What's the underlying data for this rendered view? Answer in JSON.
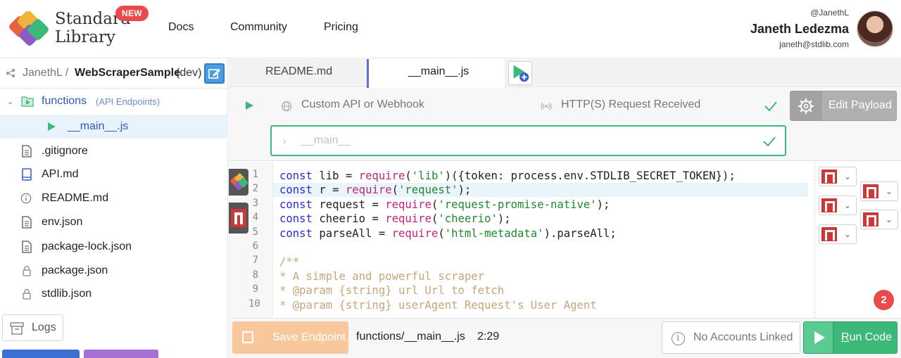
{
  "header": {
    "brand_line1": "Standard",
    "brand_line2": "Library",
    "new_badge": "NEW",
    "nav": {
      "docs": "Docs",
      "community": "Community",
      "pricing": "Pricing"
    },
    "user": {
      "handle": "@JanethL",
      "name": "Janeth Ledezma",
      "email": "janeth@stdlib.com"
    }
  },
  "sidebar": {
    "breadcrumb": {
      "owner": "JanethL /",
      "project": "WebScraperSample",
      "env": "(dev)"
    },
    "functions_folder": {
      "label": "functions",
      "sublabel": "(API Endpoints)"
    },
    "selected_file": "__main__.js",
    "files": [
      {
        "label": ".gitignore",
        "icon": "document-icon"
      },
      {
        "label": "API.md",
        "icon": "book-icon"
      },
      {
        "label": "README.md",
        "icon": "info-icon"
      },
      {
        "label": "env.json",
        "icon": "document-icon"
      },
      {
        "label": "package-lock.json",
        "icon": "document-icon"
      },
      {
        "label": "package.json",
        "icon": "lock-icon"
      },
      {
        "label": "stdlib.json",
        "icon": "lock-icon"
      }
    ],
    "logs_label": "Logs"
  },
  "editor": {
    "tabs": [
      {
        "label": "README.md",
        "active": false
      },
      {
        "label": "__main__.js",
        "active": true
      }
    ],
    "request_bar": {
      "api_label": "Custom API or Webhook",
      "http_label": "HTTP(S) Request Received",
      "edit_payload_label": "Edit Payload",
      "function_name": "__main__"
    },
    "line_numbers": [
      "1",
      "2",
      "3",
      "4",
      "5",
      "6",
      "7",
      "8",
      "9",
      "10"
    ],
    "code": [
      {
        "t": [
          [
            "kw",
            "const"
          ],
          [
            "",
            "lib = "
          ],
          [
            "fnc",
            "require"
          ],
          [
            "",
            "("
          ],
          [
            "str",
            "'lib'"
          ],
          [
            "",
            ")({token: process.env.STDLIB_SECRET_TOKEN});"
          ]
        ]
      },
      {
        "t": [
          [
            "kw",
            "const"
          ],
          [
            "",
            "r = "
          ],
          [
            "fnc",
            "require"
          ],
          [
            "",
            "("
          ],
          [
            "str",
            "'request'"
          ],
          [
            "",
            ");"
          ]
        ],
        "highlight": true
      },
      {
        "t": [
          [
            "kw",
            "const"
          ],
          [
            "",
            "request = "
          ],
          [
            "fnc",
            "require"
          ],
          [
            "",
            "("
          ],
          [
            "str",
            "'request-promise-native'"
          ],
          [
            "",
            ");"
          ]
        ]
      },
      {
        "t": [
          [
            "kw",
            "const"
          ],
          [
            "",
            "cheerio = "
          ],
          [
            "fnc",
            "require"
          ],
          [
            "",
            "("
          ],
          [
            "str",
            "'cheerio'"
          ],
          [
            "",
            ");"
          ]
        ]
      },
      {
        "t": [
          [
            "kw",
            "const"
          ],
          [
            "",
            "parseAll = "
          ],
          [
            "fnc",
            "require"
          ],
          [
            "",
            "("
          ],
          [
            "str",
            "'html-metadata'"
          ],
          [
            "",
            ").parseAll;"
          ]
        ]
      },
      {
        "t": []
      },
      {
        "t": [
          [
            "cm",
            "/**"
          ]
        ]
      },
      {
        "t": [
          [
            "cm",
            "* A simple and powerful scraper"
          ]
        ]
      },
      {
        "t": [
          [
            "cm",
            "* @param {string} url Url to fetch"
          ]
        ]
      },
      {
        "t": [
          [
            "cm",
            "* @param {string} userAgent Request's User Agent"
          ]
        ]
      }
    ],
    "notification_count": "2"
  },
  "bottom_bar": {
    "save_label": "Save Endpoint",
    "file_path": "functions/__main__.js",
    "cursor_position": "2:29",
    "accounts_label": "No Accounts Linked",
    "run_label_first": "R",
    "run_label_rest": "un Code"
  },
  "colors": {
    "accent_green": "#3cb879",
    "save_orange": "#f8c89c",
    "link_blue": "#2a5db0",
    "badge_red": "#e94b4b",
    "npm_red": "#cb3837"
  }
}
